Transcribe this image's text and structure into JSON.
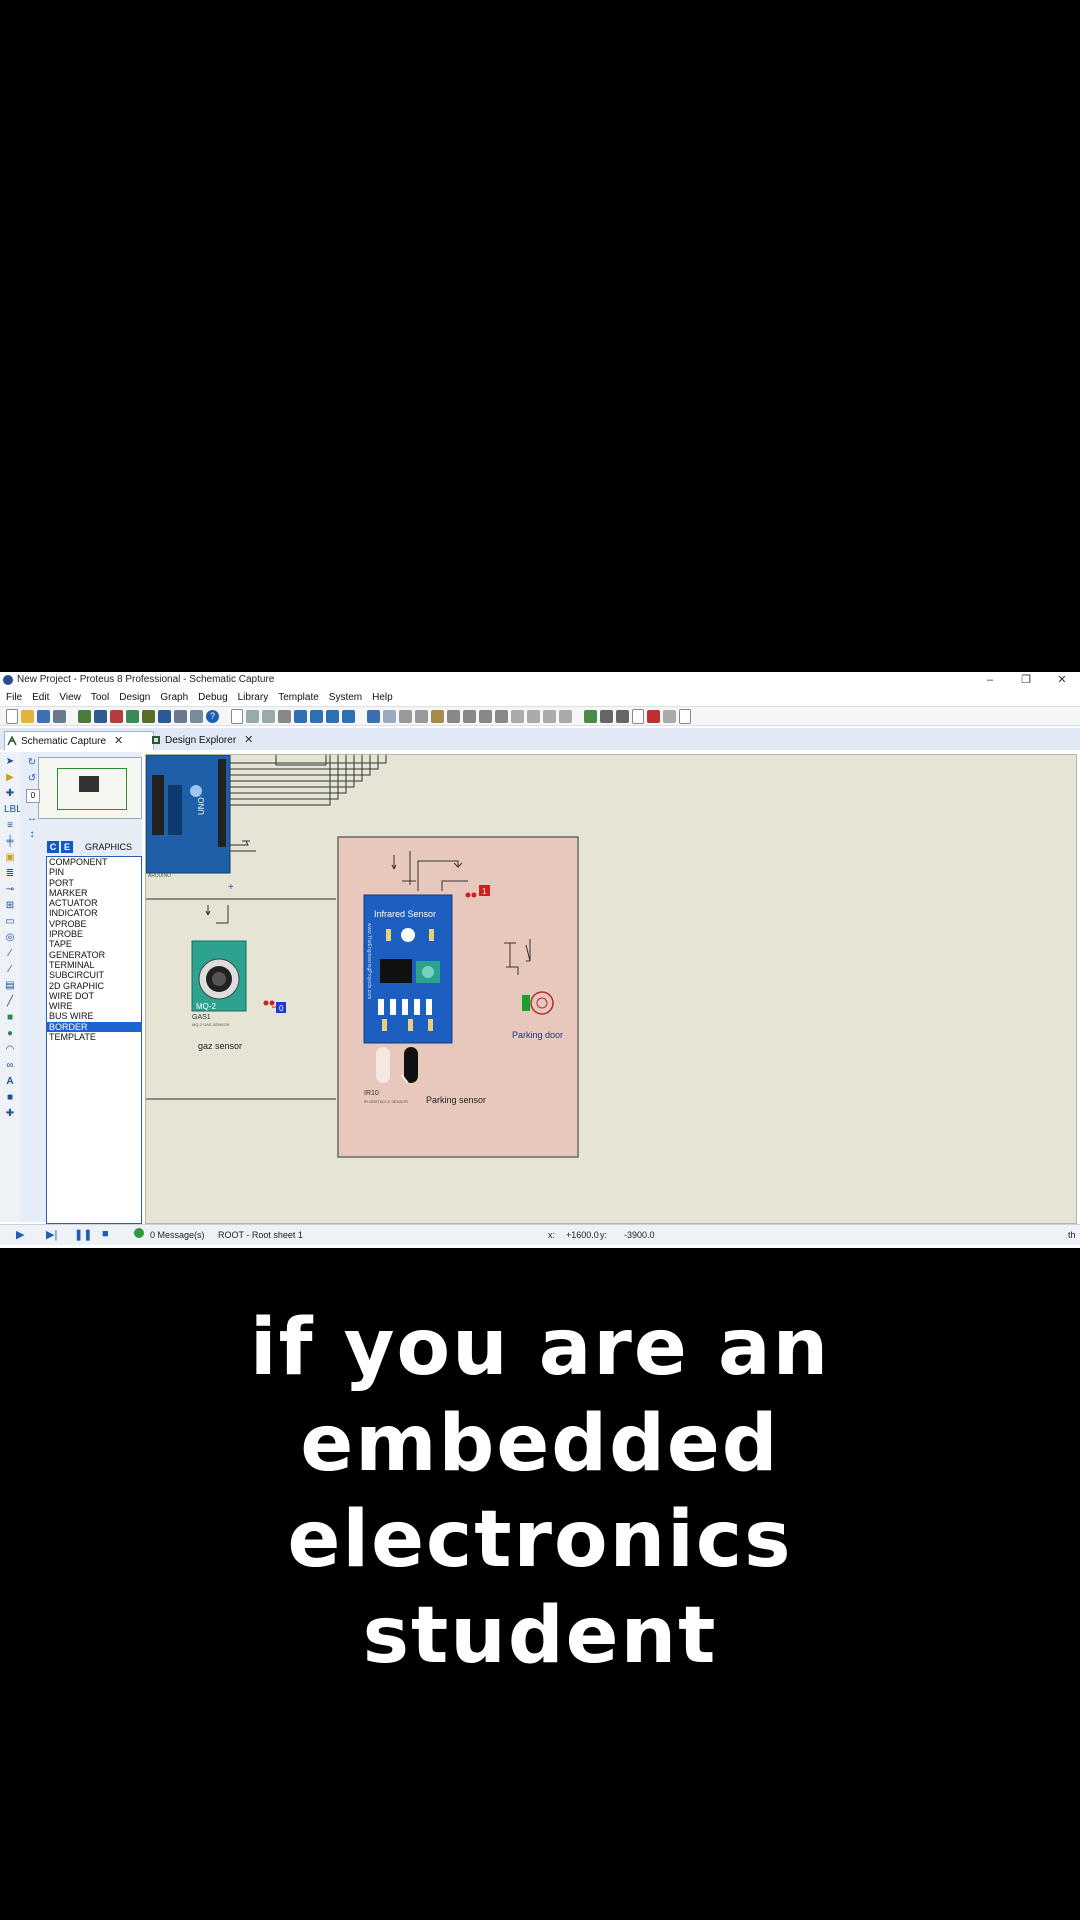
{
  "window": {
    "title": "New Project - Proteus 8 Professional - Schematic Capture",
    "controls": [
      "–",
      "❐",
      "✕"
    ]
  },
  "menu": [
    "File",
    "Edit",
    "View",
    "Tool",
    "Design",
    "Graph",
    "Debug",
    "Library",
    "Template",
    "System",
    "Help"
  ],
  "tabs": [
    {
      "label": "Schematic Capture",
      "close": "✕"
    },
    {
      "label": "Design Explorer",
      "close": "✕"
    }
  ],
  "panel": {
    "mode_buttons": [
      "C",
      "E"
    ],
    "mode_label": "GRAPHICS",
    "items": [
      "COMPONENT",
      "PIN",
      "PORT",
      "MARKER",
      "ACTUATOR",
      "INDICATOR",
      "VPROBE",
      "IPROBE",
      "TAPE",
      "GENERATOR",
      "TERMINAL",
      "SUBCIRCUIT",
      "2D GRAPHIC",
      "WIRE DOT",
      "WIRE",
      "BUS WIRE",
      "BORDER",
      "TEMPLATE"
    ],
    "selected": "BORDER"
  },
  "schematic": {
    "ir_module_title": "Infrared Sensor",
    "ir_side_text": "www.TheEngineeringProjects.com",
    "ir_label": "IR10",
    "ir_sublabel": "IR OBSTACLE SENSOR",
    "parking_sensor": "Parking sensor",
    "parking_door": "Parking door",
    "gas_module": "MQ-2",
    "gas_label": "GAS1",
    "gas_sublabel": "MQ-2 GAS SENSOR",
    "gas_sensor": "gaz sensor",
    "probe_1": "1",
    "probe_0": "0",
    "arduino_brand": "UNO",
    "arduino_label": "ARDUINO"
  },
  "status": {
    "messages": "0 Message(s)",
    "sheet": "ROOT - Root sheet 1",
    "x_label": "x:",
    "x_value": "+1600.0",
    "y_label": "y:",
    "y_value": "-3900.0",
    "units": "th"
  },
  "caption": {
    "lines": [
      "if you are an",
      "embedded",
      "electronics",
      "student"
    ]
  }
}
